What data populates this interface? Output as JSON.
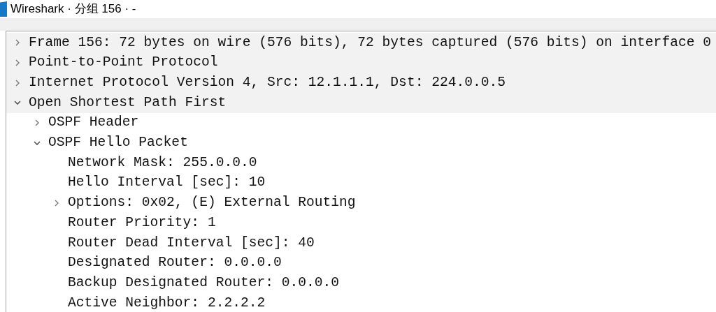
{
  "window": {
    "title": "Wireshark · 分组 156 · -"
  },
  "tree": [
    {
      "label": "Frame 156: 72 bytes on wire (576 bits), 72 bytes captured (576 bits) on interface 0",
      "expanded": false
    },
    {
      "label": "Point-to-Point Protocol",
      "expanded": false
    },
    {
      "label": "Internet Protocol Version 4, Src: 12.1.1.1, Dst: 224.0.0.5",
      "expanded": false
    },
    {
      "label": "Open Shortest Path First",
      "expanded": true,
      "children": [
        {
          "label": "OSPF Header",
          "expanded": false
        },
        {
          "label": "OSPF Hello Packet",
          "expanded": true,
          "children": [
            {
              "label": "Network Mask: 255.0.0.0"
            },
            {
              "label": "Hello Interval [sec]: 10"
            },
            {
              "label": "Options: 0x02, (E) External Routing",
              "expanded": false
            },
            {
              "label": "Router Priority: 1"
            },
            {
              "label": "Router Dead Interval [sec]: 40"
            },
            {
              "label": "Designated Router: 0.0.0.0"
            },
            {
              "label": "Backup Designated Router: 0.0.0.0"
            },
            {
              "label": "Active Neighbor: 2.2.2.2"
            }
          ]
        }
      ]
    }
  ]
}
